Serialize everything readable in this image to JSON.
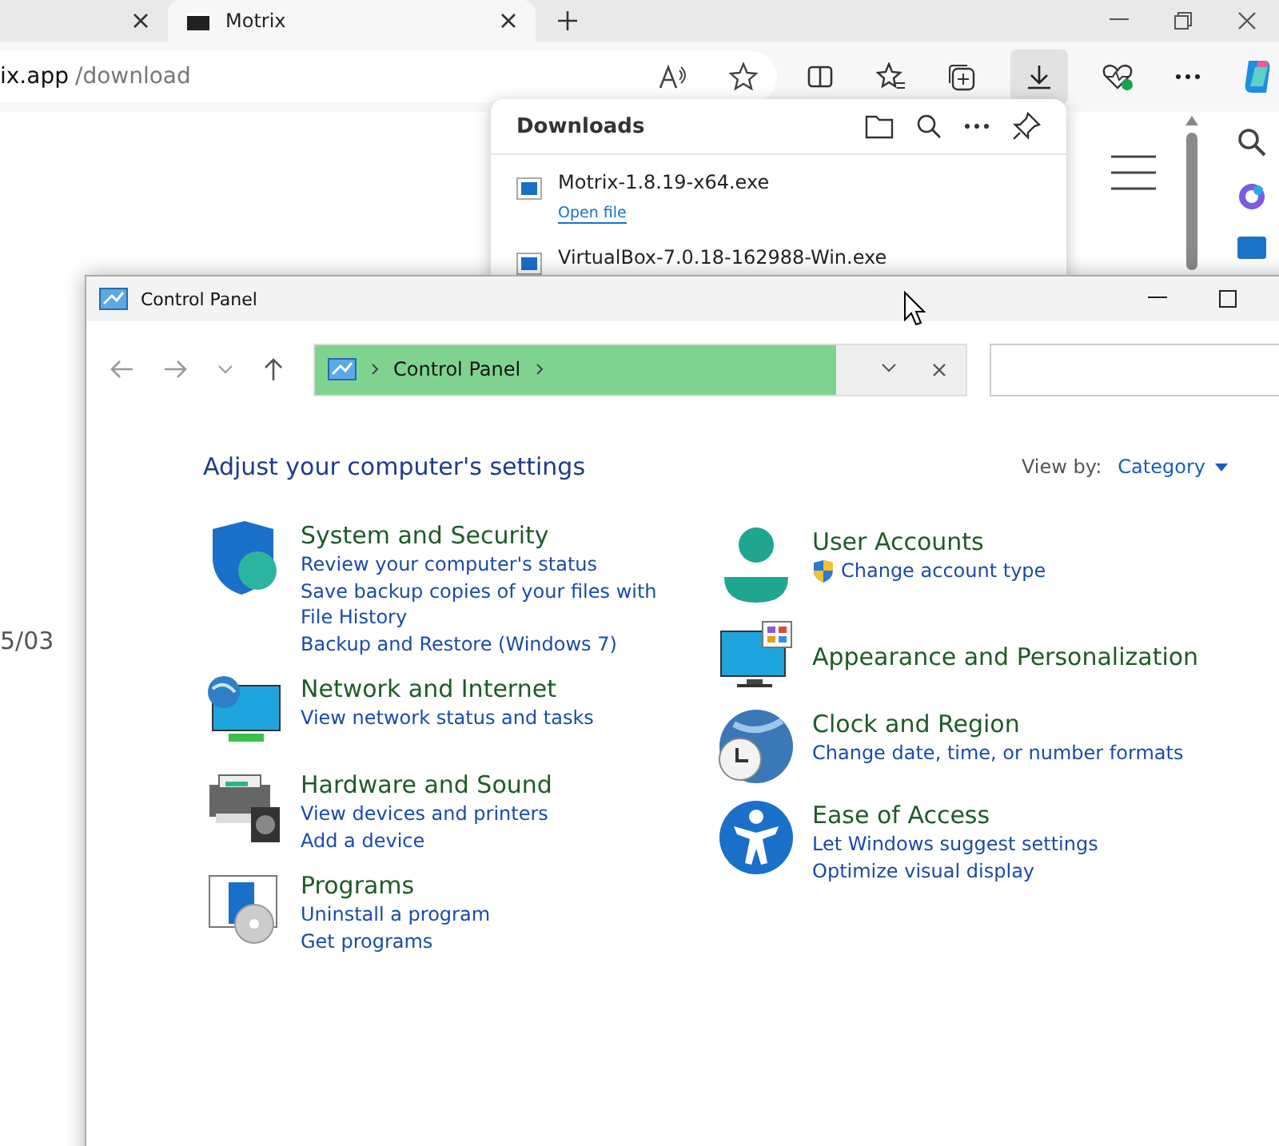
{
  "browser": {
    "tabs": [
      {
        "selected": false
      },
      {
        "title": "Motrix",
        "selected": true
      }
    ],
    "address": {
      "host": "ix.app",
      "path": "/download"
    },
    "page_text": "5/03",
    "downloads": {
      "title": "Downloads",
      "items": [
        {
          "name": "Motrix-1.8.19-x64.exe",
          "action": "Open file"
        },
        {
          "name": "VirtualBox-7.0.18-162988-Win.exe"
        }
      ]
    }
  },
  "control_panel": {
    "title": "Control Panel",
    "breadcrumb": "Control Panel",
    "heading": "Adjust your computer's settings",
    "view_by_label": "View by:",
    "view_by_value": "Category",
    "columns": [
      [
        {
          "kind": "security",
          "title": "System and Security",
          "links": [
            {
              "text": "Review your computer's status"
            },
            {
              "text": "Save backup copies of your files with File History"
            },
            {
              "text": "Backup and Restore (Windows 7)"
            }
          ]
        },
        {
          "kind": "network",
          "title": "Network and Internet",
          "links": [
            {
              "text": "View network status and tasks"
            }
          ]
        },
        {
          "kind": "hardware",
          "title": "Hardware and Sound",
          "links": [
            {
              "text": "View devices and printers"
            },
            {
              "text": "Add a device"
            }
          ]
        },
        {
          "kind": "programs",
          "title": "Programs",
          "links": [
            {
              "text": "Uninstall a program"
            },
            {
              "text": "Get programs"
            }
          ]
        }
      ],
      [
        {
          "kind": "user",
          "title": "User Accounts",
          "links": [
            {
              "text": "Change account type",
              "uac": true
            }
          ]
        },
        {
          "kind": "appearance",
          "title": "Appearance and Personalization"
        },
        {
          "kind": "clock",
          "title": "Clock and Region",
          "links": [
            {
              "text": "Change date, time, or number formats"
            }
          ]
        },
        {
          "kind": "access",
          "title": "Ease of Access",
          "links": [
            {
              "text": "Let Windows suggest settings"
            },
            {
              "text": "Optimize visual display"
            }
          ]
        }
      ]
    ]
  }
}
